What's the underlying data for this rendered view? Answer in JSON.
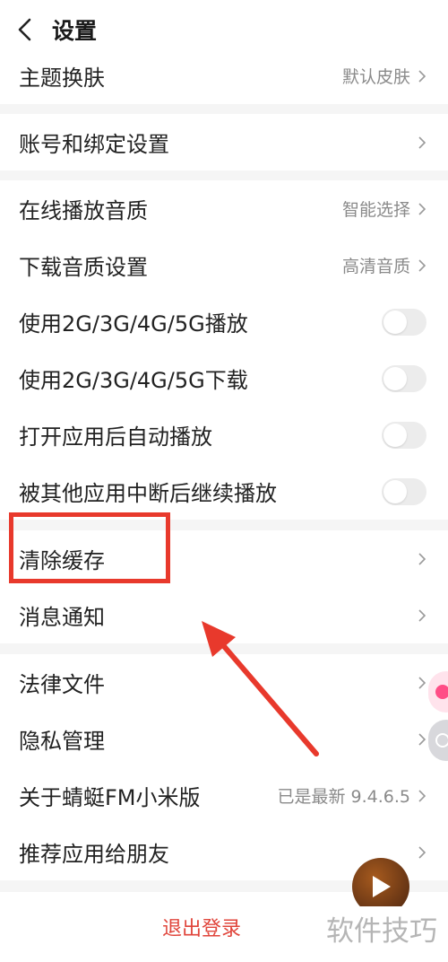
{
  "header": {
    "title": "设置"
  },
  "groups": [
    {
      "rows": [
        {
          "label": "主题换肤",
          "value": "默认皮肤"
        }
      ]
    },
    {
      "rows": [
        {
          "label": "账号和绑定设置",
          "value": ""
        }
      ]
    },
    {
      "rows": [
        {
          "label": "在线播放音质",
          "value": "智能选择"
        },
        {
          "label": "下载音质设置",
          "value": "高清音质"
        },
        {
          "label": "使用2G/3G/4G/5G播放",
          "toggle": false
        },
        {
          "label": "使用2G/3G/4G/5G下载",
          "toggle": false
        },
        {
          "label": "打开应用后自动播放",
          "toggle": false
        },
        {
          "label": "被其他应用中断后继续播放",
          "toggle": false
        }
      ]
    },
    {
      "rows": [
        {
          "label": "清除缓存",
          "value": ""
        },
        {
          "label": "消息通知",
          "value": ""
        }
      ]
    },
    {
      "rows": [
        {
          "label": "法律文件",
          "value": ""
        },
        {
          "label": "隐私管理",
          "value": ""
        },
        {
          "label": "关于蜻蜓FM小米版",
          "value": "已是最新 9.4.6.5"
        },
        {
          "label": "推荐应用给朋友",
          "value": ""
        }
      ]
    }
  ],
  "footer": {
    "logout_label": "退出登录"
  },
  "watermark": "软件技巧",
  "colors": {
    "accent": "#e0453b",
    "annotation": "#e8392c"
  }
}
